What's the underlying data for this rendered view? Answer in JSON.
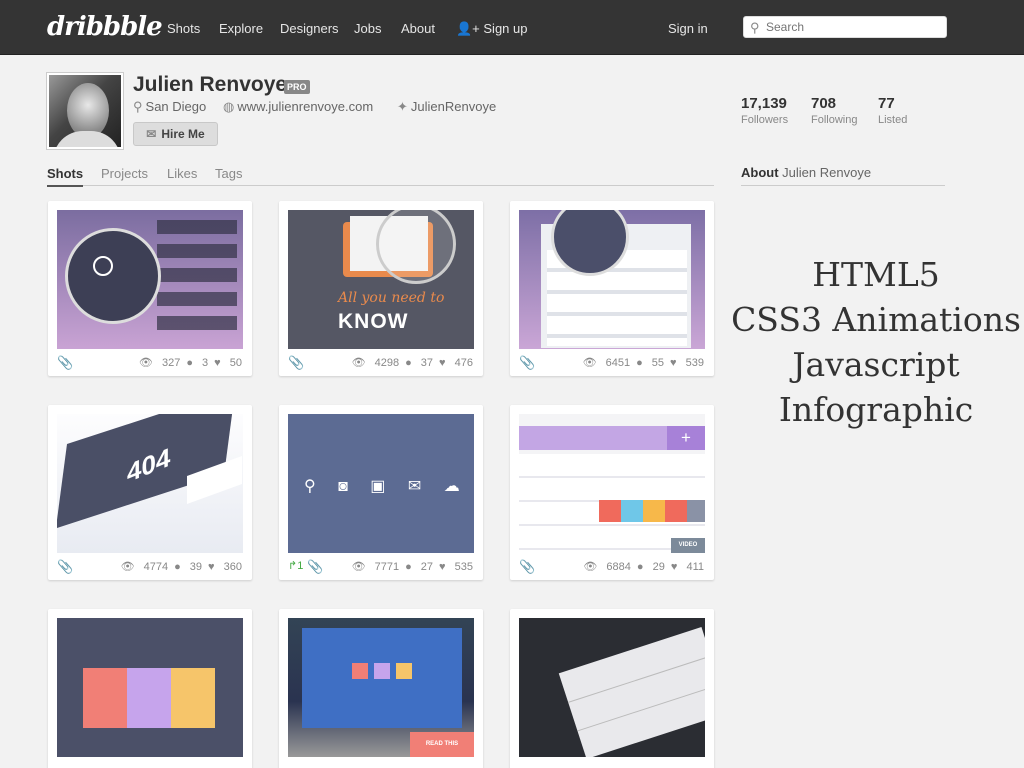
{
  "header": {
    "logo": "dribbble",
    "nav": [
      "Shots",
      "Explore",
      "Designers",
      "Jobs",
      "About",
      "Sign up"
    ],
    "sign_in": "Sign in",
    "search_placeholder": "Search"
  },
  "profile": {
    "name": "Julien Renvoye",
    "badge": "PRO",
    "location": "San Diego",
    "website": "www.julienrenvoye.com",
    "twitter": "JulienRenvoye",
    "hire": "Hire Me"
  },
  "stats": [
    {
      "num": "17,139",
      "label": "Followers"
    },
    {
      "num": "708",
      "label": "Following"
    },
    {
      "num": "77",
      "label": "Listed"
    }
  ],
  "tabs": [
    "Shots",
    "Projects",
    "Likes",
    "Tags"
  ],
  "about": {
    "prefix": "About",
    "name": "Julien Renvoye"
  },
  "skills": [
    "HTML5",
    "CSS3 Animations",
    "Javascript",
    "Infographic"
  ],
  "shots": [
    {
      "views": "327",
      "comments": "3",
      "likes": "50",
      "art_text": []
    },
    {
      "views": "4298",
      "comments": "37",
      "likes": "476",
      "art_text": [
        "All you need to",
        "KNOW"
      ]
    },
    {
      "views": "6451",
      "comments": "55",
      "likes": "539",
      "art_text": []
    },
    {
      "views": "4774",
      "comments": "39",
      "likes": "360",
      "art_text": [
        "404"
      ]
    },
    {
      "views": "7771",
      "comments": "27",
      "likes": "535",
      "rebound": "1"
    },
    {
      "views": "6884",
      "comments": "29",
      "likes": "411",
      "art_text": [
        "VIDEO"
      ]
    },
    {
      "art_text": []
    },
    {
      "art_text": [
        "READ THIS"
      ]
    },
    {
      "art_text": []
    }
  ],
  "colors": {
    "topbar": "#343434",
    "background": "#f2f2f2",
    "accent_pink": "#f17f76"
  }
}
